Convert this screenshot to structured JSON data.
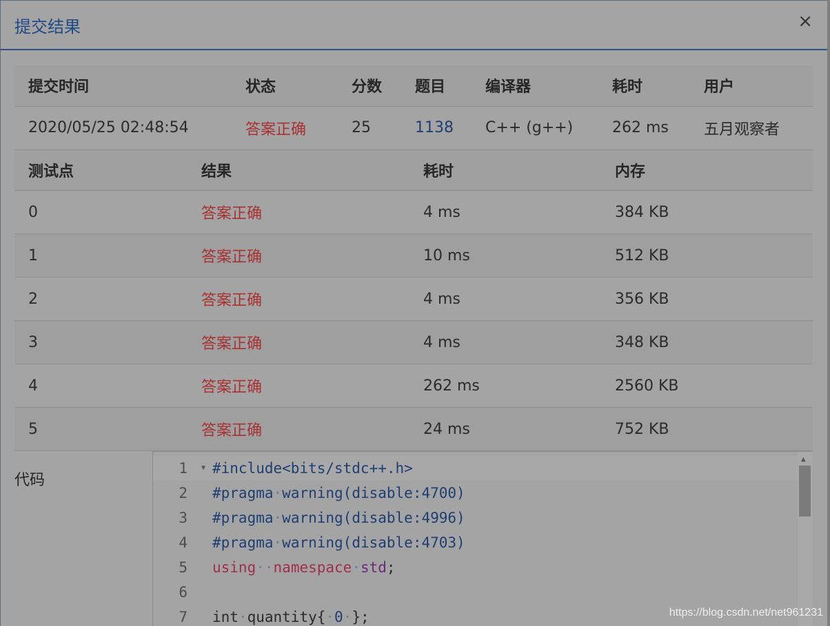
{
  "dialog": {
    "title": "提交结果",
    "close_label": "×"
  },
  "summary": {
    "headers": [
      "提交时间",
      "状态",
      "分数",
      "题目",
      "编译器",
      "耗时",
      "用户"
    ],
    "row": {
      "time": "2020/05/25 02:48:54",
      "status": "答案正确",
      "score": "25",
      "problem": "1138",
      "compiler": "C++ (g++)",
      "duration": "262 ms",
      "user": "五月观察者"
    }
  },
  "cases": {
    "headers": [
      "测试点",
      "结果",
      "耗时",
      "内存"
    ],
    "rows": [
      {
        "id": "0",
        "result": "答案正确",
        "time": "4 ms",
        "memory": "384 KB"
      },
      {
        "id": "1",
        "result": "答案正确",
        "time": "10 ms",
        "memory": "512 KB"
      },
      {
        "id": "2",
        "result": "答案正确",
        "time": "4 ms",
        "memory": "356 KB"
      },
      {
        "id": "3",
        "result": "答案正确",
        "time": "4 ms",
        "memory": "348 KB"
      },
      {
        "id": "4",
        "result": "答案正确",
        "time": "262 ms",
        "memory": "2560 KB"
      },
      {
        "id": "5",
        "result": "答案正确",
        "time": "24 ms",
        "memory": "752 KB"
      }
    ]
  },
  "code": {
    "label": "代码",
    "line_numbers": [
      "1",
      "2",
      "3",
      "4",
      "5",
      "6",
      "7"
    ],
    "lines": {
      "l1": "#include<bits/stdc++.h>",
      "l2_pragma": "#pragma",
      "l2_rest": "warning(disable:4700)",
      "l3_pragma": "#pragma",
      "l3_rest": "warning(disable:4996)",
      "l4_pragma": "#pragma",
      "l4_rest": "warning(disable:4703)",
      "l5_using": "using",
      "l5_namespace": "namespace",
      "l5_std": "std",
      "l5_semi": ";",
      "l7_int": "int",
      "l7_name": "quantity{",
      "l7_zero": "0",
      "l7_end": "};"
    },
    "space_marker": "·"
  },
  "watermark": "https://blog.csdn.net/net961231"
}
